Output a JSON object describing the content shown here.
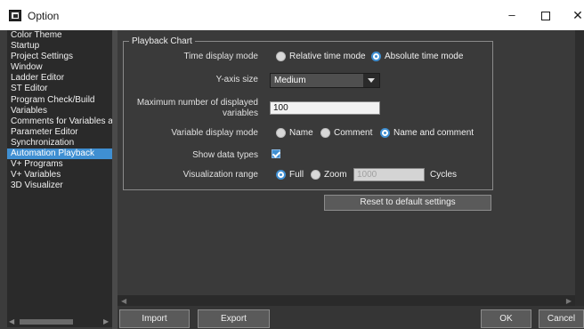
{
  "window": {
    "title": "Option",
    "minimize_label": "–",
    "close_label": "✕"
  },
  "sidebar": {
    "items": [
      {
        "label": "Color Theme"
      },
      {
        "label": "Startup"
      },
      {
        "label": "Project Settings"
      },
      {
        "label": "Window"
      },
      {
        "label": "Ladder Editor"
      },
      {
        "label": "ST Editor"
      },
      {
        "label": "Program Check/Build"
      },
      {
        "label": "Variables"
      },
      {
        "label": "Comments for Variables a"
      },
      {
        "label": "Parameter Editor"
      },
      {
        "label": "Synchronization"
      },
      {
        "label": "Automation Playback"
      },
      {
        "label": "V+ Programs"
      },
      {
        "label": "V+ Variables"
      },
      {
        "label": "3D Visualizer"
      }
    ],
    "selected": "Automation Playback",
    "scroll_left_arrow": "◀",
    "scroll_right_arrow": "▶"
  },
  "group": {
    "title": "Playback Chart"
  },
  "settings": {
    "time_display_mode": {
      "label": "Time display mode",
      "options": [
        "Relative time mode",
        "Absolute time mode"
      ],
      "selected": "Absolute time mode"
    },
    "y_axis_size": {
      "label": "Y-axis size",
      "value": "Medium"
    },
    "max_displayed_variables": {
      "label_line1": "Maximum number of displayed",
      "label_line2": "variables",
      "value": "100"
    },
    "variable_display_mode": {
      "label": "Variable display mode",
      "options": [
        "Name",
        "Comment",
        "Name and comment"
      ],
      "selected": "Name and comment"
    },
    "show_data_types": {
      "label": "Show data types",
      "checked": true
    },
    "visualization_range": {
      "label": "Visualization range",
      "options": [
        "Full",
        "Zoom"
      ],
      "selected": "Full",
      "zoom_value": "1000",
      "unit": "Cycles"
    }
  },
  "buttons": {
    "reset": "Reset to default settings",
    "import": "Import",
    "export": "Export",
    "ok": "OK",
    "cancel": "Cancel"
  },
  "colors": {
    "accent": "#3f8fd2",
    "background": "#3a3a3a",
    "sidebar_bg": "#2a2a2a"
  }
}
